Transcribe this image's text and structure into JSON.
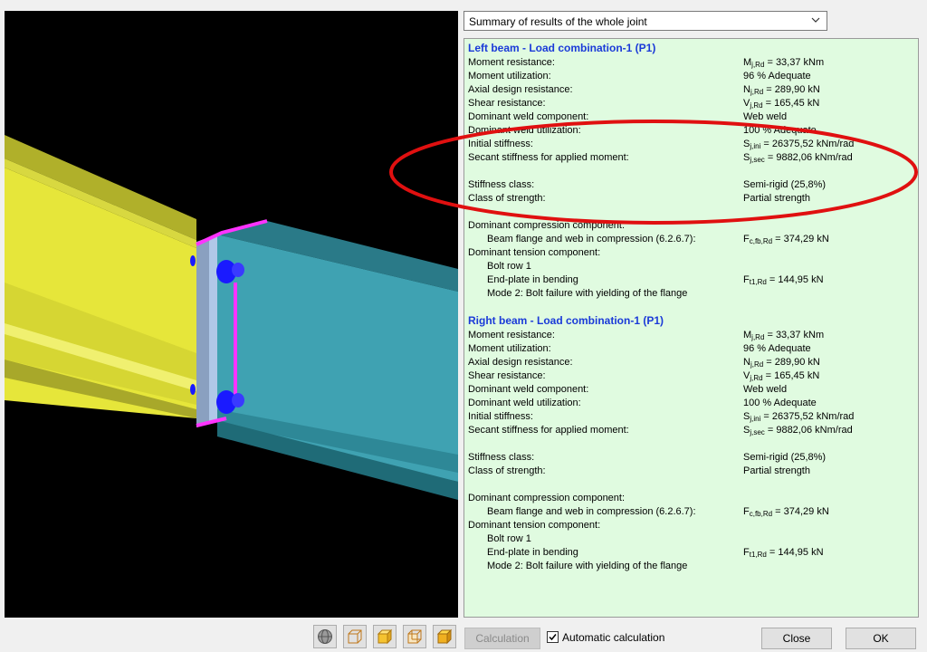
{
  "dropdown": {
    "value": "Summary of results of the whole joint"
  },
  "left": {
    "title": "Left beam - Load combination-1 (P1)",
    "rows": [
      {
        "label": "Moment resistance:",
        "sym": "M",
        "sub": "j,Rd",
        "val": " = 33,37 kNm"
      },
      {
        "label": "Moment utilization:",
        "sym": "",
        "sub": "",
        "val": "96 % Adequate"
      },
      {
        "label": "Axial design resistance:",
        "sym": "N",
        "sub": "j,Rd",
        "val": " = 289,90 kN"
      },
      {
        "label": "Shear resistance:",
        "sym": "V",
        "sub": "j,Rd",
        "val": " = 165,45 kN"
      },
      {
        "label": "Dominant weld component:",
        "sym": "",
        "sub": "",
        "val": "Web weld"
      },
      {
        "label": "Dominant weld utilization:",
        "sym": "",
        "sub": "",
        "val": "100 % Adequate"
      },
      {
        "label": "Initial stiffness:",
        "sym": "S",
        "sub": "j,ini",
        "val": " = 26375,52 kNm/rad"
      },
      {
        "label": "Secant stiffness for applied moment:",
        "sym": "S",
        "sub": "j,sec",
        "val": " = 9882,06 kNm/rad"
      }
    ],
    "stiffness_class_label": "Stiffness class:",
    "stiffness_class_value": "Semi-rigid (25,8%)",
    "strength_class_label": "Class of strength:",
    "strength_class_value": "Partial strength",
    "dom_comp_label": "Dominant compression component:",
    "dom_comp_item": "Beam flange and web in compression (6.2.6.7):",
    "dom_comp_sym": "F",
    "dom_comp_sub": "c,fb,Rd",
    "dom_comp_val": " = 374,29 kN",
    "dom_tens_label": "Dominant tension component:",
    "bolt_row": "Bolt row 1",
    "endplate": "End-plate in bending",
    "endplate_sym": "F",
    "endplate_sub": "t1,Rd",
    "endplate_val": " =  144,95 kN",
    "mode": "Mode 2: Bolt failure with yielding of the flange"
  },
  "right": {
    "title": "Right beam - Load combination-1 (P1)",
    "rows": [
      {
        "label": "Moment resistance:",
        "sym": "M",
        "sub": "j,Rd",
        "val": " = 33,37 kNm"
      },
      {
        "label": "Moment utilization:",
        "sym": "",
        "sub": "",
        "val": "96 % Adequate"
      },
      {
        "label": "Axial design resistance:",
        "sym": "N",
        "sub": "j,Rd",
        "val": " = 289,90 kN"
      },
      {
        "label": "Shear resistance:",
        "sym": "V",
        "sub": "j,Rd",
        "val": " = 165,45 kN"
      },
      {
        "label": "Dominant weld component:",
        "sym": "",
        "sub": "",
        "val": "Web weld"
      },
      {
        "label": "Dominant weld utilization:",
        "sym": "",
        "sub": "",
        "val": "100 % Adequate"
      },
      {
        "label": "Initial stiffness:",
        "sym": "S",
        "sub": "j,ini",
        "val": " = 26375,52 kNm/rad"
      },
      {
        "label": "Secant stiffness for applied moment:",
        "sym": "S",
        "sub": "j,sec",
        "val": " = 9882,06 kNm/rad"
      }
    ],
    "stiffness_class_label": "Stiffness class:",
    "stiffness_class_value": "Semi-rigid (25,8%)",
    "strength_class_label": "Class of strength:",
    "strength_class_value": "Partial strength",
    "dom_comp_label": "Dominant compression component:",
    "dom_comp_item": "Beam flange and web in compression (6.2.6.7):",
    "dom_comp_sym": "F",
    "dom_comp_sub": "c,fb,Rd",
    "dom_comp_val": " = 374,29 kN",
    "dom_tens_label": "Dominant tension component:",
    "bolt_row": "Bolt row 1",
    "endplate": "End-plate in bending",
    "endplate_sym": "F",
    "endplate_sub": "t1,Rd",
    "endplate_val": " =  144,95 kN",
    "mode": "Mode 2: Bolt failure with yielding of the flange"
  },
  "toolbar": {
    "icons": [
      "render-sphere-icon",
      "wireframe-cube-icon",
      "solid-cube-icon",
      "transparent-cube-icon",
      "shaded-cube-icon"
    ],
    "calculation_label": "Calculation",
    "auto_calc_label": "Automatic calculation",
    "auto_calc_checked": true,
    "close_label": "Close",
    "ok_label": "OK"
  },
  "colors": {
    "panel_bg": "#e0fbe0",
    "heading": "#1a3ad8",
    "highlight_ellipse": "#e01010",
    "left_beam": "#e6e63a",
    "right_beam": "#3fa2b2",
    "weld": "#ff33ff",
    "bolts": "#1a1aff"
  }
}
